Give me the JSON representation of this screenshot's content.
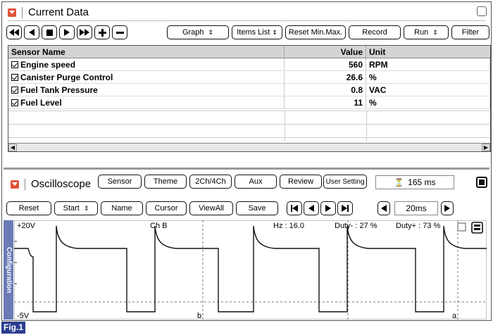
{
  "current_data": {
    "title": "Current Data",
    "toolbar": {
      "graph": "Graph",
      "items_list": "Items List",
      "reset_min_max": "Reset Min.Max.",
      "record": "Record",
      "run": "Run",
      "filter": "Filter"
    },
    "table": {
      "headers": [
        "Sensor Name",
        "Value",
        "Unit"
      ],
      "rows": [
        {
          "name": "Engine speed",
          "value": "560",
          "unit": "RPM"
        },
        {
          "name": "Canister Purge Control",
          "value": "26.6",
          "unit": "%"
        },
        {
          "name": "Fuel Tank Pressure",
          "value": "0.8",
          "unit": "VAC"
        },
        {
          "name": "Fuel Level",
          "value": "11",
          "unit": "%"
        }
      ]
    }
  },
  "oscilloscope": {
    "title": "Oscilloscope",
    "buttons": {
      "sensor": "Sensor",
      "theme": "Theme",
      "channels": "2Ch/4Ch",
      "aux": "Aux",
      "review": "Review",
      "user_setting": "User Setting",
      "reset": "Reset",
      "start": "Start",
      "name": "Name",
      "cursor": "Cursor",
      "view_all": "ViewAll",
      "save": "Save"
    },
    "time_readout": "165 ms",
    "zoom": "20ms",
    "config_tab": "Configuration",
    "scope": {
      "top_label": "+20V",
      "bottom_label": "-5V",
      "channel": "Ch B",
      "hz_label": "Hz : 16.0",
      "duty_minus": "Duty- : 27 %",
      "duty_plus": "Duty+ : 73 %",
      "cursor_b": "b",
      "cursor_a": "a"
    }
  },
  "figure_label": "Fig.1"
}
